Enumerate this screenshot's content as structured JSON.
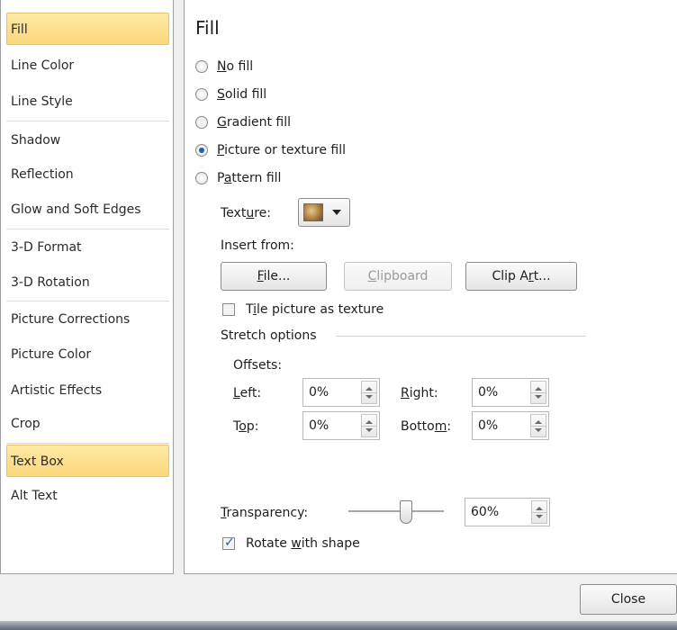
{
  "sidebar": {
    "items": [
      {
        "label": "Fill",
        "selected": true
      },
      {
        "label": "Line Color",
        "selected": false
      },
      {
        "label": "Line Style",
        "selected": false
      },
      {
        "label": "Shadow",
        "selected": false
      },
      {
        "label": "Reflection",
        "selected": false
      },
      {
        "label": "Glow and Soft Edges",
        "selected": false
      },
      {
        "label": "3-D Format",
        "selected": false
      },
      {
        "label": "3-D Rotation",
        "selected": false
      },
      {
        "label": "Picture Corrections",
        "selected": false
      },
      {
        "label": "Picture Color",
        "selected": false
      },
      {
        "label": "Artistic Effects",
        "selected": false
      },
      {
        "label": "Crop",
        "selected": false
      },
      {
        "label": "Text Box",
        "selected": true
      },
      {
        "label": "Alt Text",
        "selected": false
      }
    ]
  },
  "fill": {
    "title": "Fill",
    "options": [
      {
        "pre": "",
        "key": "N",
        "post": "o fill",
        "checked": false
      },
      {
        "pre": "",
        "key": "S",
        "post": "olid fill",
        "checked": false
      },
      {
        "pre": "",
        "key": "G",
        "post": "radient fill",
        "checked": false
      },
      {
        "pre": "",
        "key": "P",
        "post": "icture or texture fill",
        "checked": true
      },
      {
        "pre": "P",
        "key": "a",
        "post": "ttern fill",
        "checked": false
      }
    ],
    "texture": {
      "pre": "Text",
      "key": "u",
      "post": "re:"
    },
    "insert_from": "Insert from:",
    "buttons": {
      "file": {
        "pre": "",
        "key": "F",
        "post": "ile..."
      },
      "clipboard": {
        "pre": "",
        "key": "C",
        "post": "lipboard"
      },
      "clipart": {
        "pre": "Clip A",
        "key": "r",
        "post": "t..."
      }
    },
    "tile": {
      "pre": "T",
      "key": "i",
      "post": "le picture as texture",
      "checked": false
    },
    "stretch_options": "Stretch options",
    "offsets": "Offsets:",
    "left": {
      "pre": "",
      "key": "L",
      "post": "eft:",
      "value": "0%"
    },
    "right": {
      "pre": "",
      "key": "R",
      "post": "ight:",
      "value": "0%"
    },
    "top": {
      "pre": "T",
      "key": "o",
      "post": "p:",
      "value": "0%"
    },
    "bottom": {
      "pre": "Botto",
      "key": "m",
      "post": ":",
      "value": "0%"
    },
    "transparency": {
      "pre": "",
      "key": "T",
      "post": "ransparency:",
      "value": "60%",
      "level": 0.6
    },
    "rotate": {
      "pre": "Rotate ",
      "key": "w",
      "post": "ith shape",
      "checked": true
    }
  },
  "footer": {
    "close_label": "Close"
  },
  "colors": {
    "selection": "#fbd77c",
    "accent": "#1f5fa8"
  }
}
